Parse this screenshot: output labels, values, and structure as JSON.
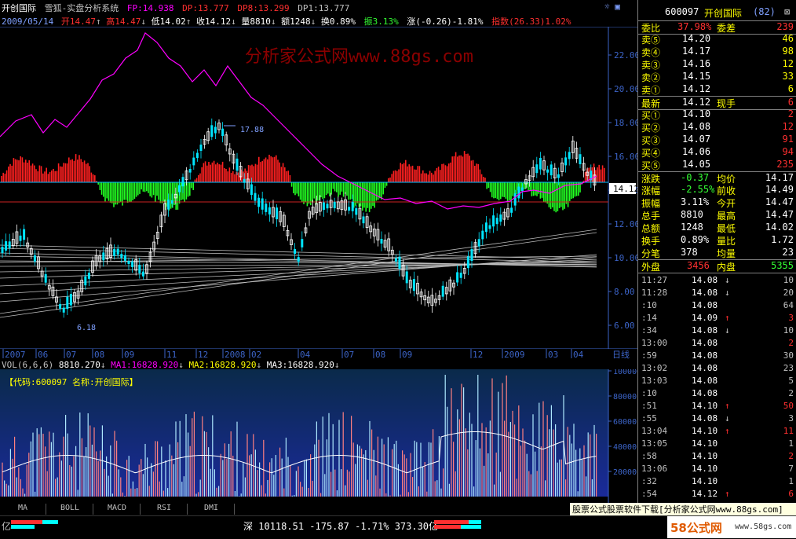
{
  "header": {
    "stock_name": "开创国际",
    "indicator_title": "雪狐-实盘分析系统",
    "fp_label": "FP:14.938",
    "dp_label": "DP:13.777",
    "dp8_label": "DP8:13.299",
    "dp1_label": "DP1:13.777",
    "date": "2009/05/14",
    "open_label": "开14.47",
    "high_label": "高14.47",
    "low_label": "低14.02",
    "close_label": "收14.12",
    "volume_label": "量8810",
    "amount_label": "额1248",
    "turnover_label": "换0.89%",
    "amplitude_label": "振3.13%",
    "change_label": "涨(-0.26)-1.81%",
    "index_label": "指数(26.33)1.02%"
  },
  "watermark": "分析家公式网www.88gs.com",
  "main_chart": {
    "y_axis_ticks": [
      "22.00",
      "20.00",
      "18.00",
      "16.00",
      "14.00",
      "12.00",
      "10.00",
      "8.00",
      "6.00"
    ],
    "current_price_tag": "14.12",
    "high_annotation": "17.88",
    "low_annotation": "6.18",
    "x_axis_ticks": [
      "2007",
      "06",
      "07",
      "08",
      "09",
      "11",
      "12",
      "2008",
      "02",
      "04",
      "07",
      "08",
      "09",
      "12",
      "2009",
      "03",
      "04"
    ],
    "x_axis_corner": "日线"
  },
  "volume_chart": {
    "header_vol": "VOL(6,6,6)",
    "vol_value": "8810.270",
    "ma1_label": "MA1:16828.920",
    "ma2_label": "MA2:16828.920",
    "ma3_label": "MA3:16828.920",
    "code_label": "【代码:600097  名称:开创国际】",
    "y_axis_ticks": [
      "100000",
      "80000",
      "60000",
      "40000",
      "20000"
    ]
  },
  "right_panel": {
    "code": "600097",
    "name": "开创国际",
    "num": "(82)",
    "weibi_label": "委比",
    "weibi_value": "37.98%",
    "weicha_label": "委差",
    "weicha_value": "239",
    "sell": [
      {
        "label": "卖⑤",
        "price": "14.20",
        "vol": "46"
      },
      {
        "label": "卖④",
        "price": "14.17",
        "vol": "98"
      },
      {
        "label": "卖③",
        "price": "14.16",
        "vol": "12"
      },
      {
        "label": "卖②",
        "price": "14.15",
        "vol": "33"
      },
      {
        "label": "卖①",
        "price": "14.12",
        "vol": "6"
      }
    ],
    "latest_label": "最新",
    "latest_value": "14.12",
    "xianshou_label": "现手",
    "xianshou_value": "6",
    "buy": [
      {
        "label": "买①",
        "price": "14.10",
        "vol": "2"
      },
      {
        "label": "买②",
        "price": "14.08",
        "vol": "12"
      },
      {
        "label": "买③",
        "price": "14.07",
        "vol": "91"
      },
      {
        "label": "买④",
        "price": "14.06",
        "vol": "94"
      },
      {
        "label": "买⑤",
        "price": "14.05",
        "vol": "235"
      }
    ],
    "stats": [
      {
        "l1": "涨跌",
        "v1": "-0.37",
        "l2": "均价",
        "v2": "14.17"
      },
      {
        "l1": "涨幅",
        "v1": "-2.55%",
        "l2": "前收",
        "v2": "14.49"
      },
      {
        "l1": "振幅",
        "v1": "3.11%",
        "l2": "今开",
        "v2": "14.47"
      },
      {
        "l1": "总手",
        "v1": "8810",
        "l2": "最高",
        "v2": "14.47"
      },
      {
        "l1": "总额",
        "v1": "1248",
        "l2": "最低",
        "v2": "14.02"
      },
      {
        "l1": "换手",
        "v1": "0.89%",
        "l2": "量比",
        "v2": "1.72"
      },
      {
        "l1": "分笔",
        "v1": "378",
        "l2": "均量",
        "v2": "23"
      }
    ],
    "waipan_label": "外盘",
    "waipan_value": "3456",
    "neipan_label": "内盘",
    "neipan_value": "5355",
    "ticks": [
      {
        "time": "11:27",
        "price": "14.08",
        "dir": "↓",
        "vol": "10",
        "color": "#c0c0c0"
      },
      {
        "time": "11:28",
        "price": "14.08",
        "dir": "↓",
        "vol": "20",
        "color": "#c0c0c0"
      },
      {
        "time": ":10",
        "price": "14.08",
        "dir": "",
        "vol": "64",
        "color": "#c0c0c0"
      },
      {
        "time": ":14",
        "price": "14.09",
        "dir": "↑",
        "vol": "3",
        "color": "#ff3030"
      },
      {
        "time": ":34",
        "price": "14.08",
        "dir": "↓",
        "vol": "10",
        "color": "#c0c0c0"
      },
      {
        "time": "13:00",
        "price": "14.08",
        "dir": "",
        "vol": "2",
        "color": "#ff3030"
      },
      {
        "time": ":59",
        "price": "14.08",
        "dir": "",
        "vol": "30",
        "color": "#c0c0c0"
      },
      {
        "time": "13:02",
        "price": "14.08",
        "dir": "",
        "vol": "23",
        "color": "#c0c0c0"
      },
      {
        "time": "13:03",
        "price": "14.08",
        "dir": "",
        "vol": "5",
        "color": "#c0c0c0"
      },
      {
        "time": ":10",
        "price": "14.08",
        "dir": "",
        "vol": "2",
        "color": "#c0c0c0"
      },
      {
        "time": ":51",
        "price": "14.10",
        "dir": "↑",
        "vol": "50",
        "color": "#ff3030"
      },
      {
        "time": ":55",
        "price": "14.08",
        "dir": "↓",
        "vol": "3",
        "color": "#c0c0c0"
      },
      {
        "time": "13:04",
        "price": "14.10",
        "dir": "↑",
        "vol": "11",
        "color": "#ff3030"
      },
      {
        "time": "13:05",
        "price": "14.10",
        "dir": "",
        "vol": "1",
        "color": "#c0c0c0"
      },
      {
        "time": ":58",
        "price": "14.10",
        "dir": "",
        "vol": "2",
        "color": "#ff3030"
      },
      {
        "time": "13:06",
        "price": "14.10",
        "dir": "",
        "vol": "7",
        "color": "#c0c0c0"
      },
      {
        "time": ":32",
        "price": "14.10",
        "dir": "",
        "vol": "1",
        "color": "#c0c0c0"
      },
      {
        "time": ":54",
        "price": "14.12",
        "dir": "↑",
        "vol": "6",
        "color": "#ff3030"
      }
    ]
  },
  "tabs": [
    "MA",
    "BOLL",
    "MACD",
    "RSI",
    "DMI"
  ],
  "ad_text": "股票公式股票软件下载[分析家公式网www.88gs.com]",
  "logo_text": "58公式网",
  "logo_url": "www.58gs.com",
  "status": {
    "left_text": "亿",
    "shen_label": "深",
    "shen_index": "10118.51",
    "shen_change": "-175.87",
    "shen_pct": "-1.71%",
    "shen_amount": "373.30亿"
  },
  "colors": {
    "red": "#ff3030",
    "green": "#33ff33",
    "yellow": "#ffff00",
    "magenta": "#ff00ff",
    "cyan": "#00ffff",
    "axis_blue": "#3c64c8"
  }
}
